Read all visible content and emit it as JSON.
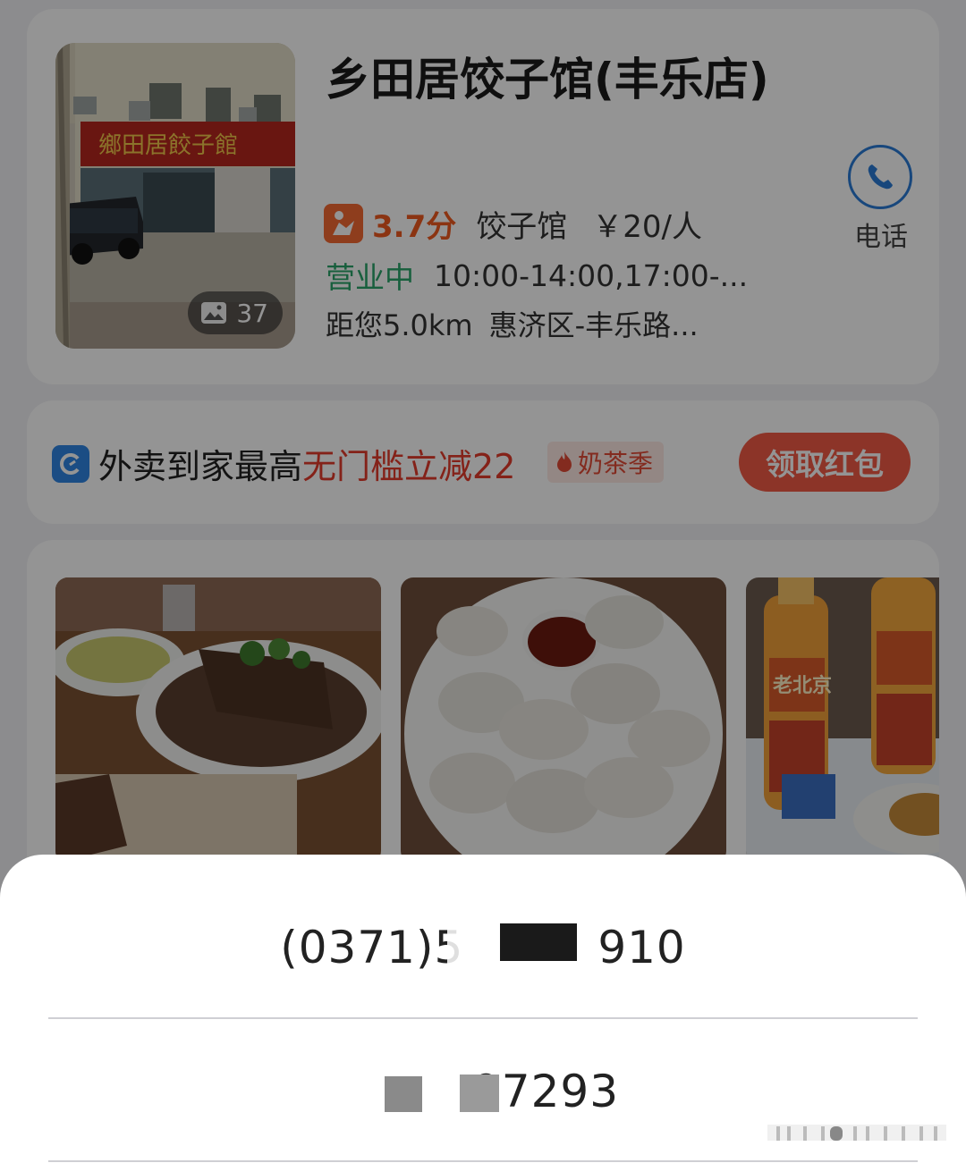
{
  "shop": {
    "name": "乡田居饺子馆(丰乐店)",
    "photo_count": "37",
    "score": "3.7分",
    "category": "饺子馆",
    "price": "￥20/人",
    "open_status": "营业中",
    "hours": "10:00-14:00,17:00-...",
    "distance": "距您5.0km",
    "address": "惠济区-丰乐路...",
    "call_label": "电话",
    "storefront_sign": "鄉田居餃子館"
  },
  "promo": {
    "main_text": "外卖到家最高",
    "highlight_text": "无门槛立减22",
    "tag": "奶茶季",
    "claim_button": "领取红包"
  },
  "photos": {
    "drink_label": "老北京"
  },
  "phone_sheet": {
    "options": [
      {
        "prefix": "(0371)5",
        "suffix": "910"
      },
      {
        "prefix": "",
        "suffix": "97293"
      }
    ]
  },
  "colors": {
    "accent_orange": "#f05a1f",
    "open_green": "#2aa46a",
    "promo_red": "#e33c2b",
    "call_blue": "#2a7bd6"
  }
}
